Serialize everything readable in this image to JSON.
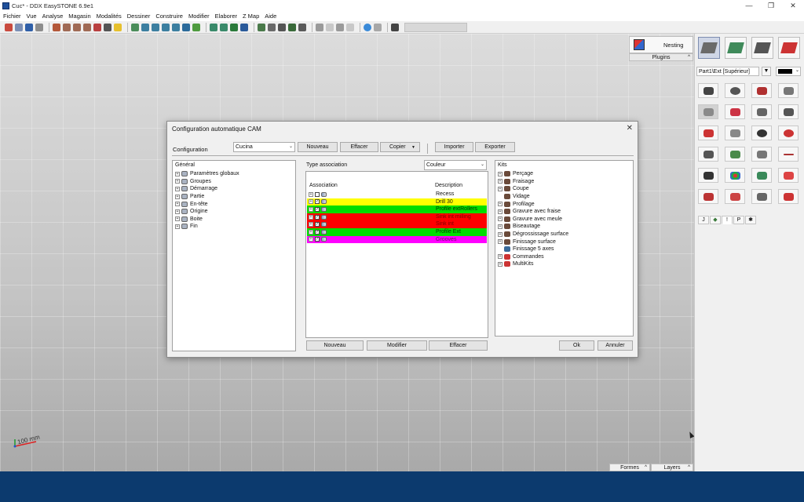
{
  "window": {
    "title": "Cuc* - DDX EasySTONE 6.9e1",
    "controls": [
      "—",
      "❐",
      "✕"
    ]
  },
  "menu": [
    "Fichier",
    "Vue",
    "Analyse",
    "Magasin",
    "Modalités",
    "Dessiner",
    "Construire",
    "Modifier",
    "Elaborer",
    "Z Map",
    "Aide"
  ],
  "viewport": {
    "scale_label": "100 mm"
  },
  "right_panel": {
    "nesting_label": "Nesting",
    "plugins_label": "Plugins",
    "part_view": "Part1\\Ext [Supérieur]",
    "current_color": "#000000"
  },
  "bottom_tabs": {
    "formes": "Formes",
    "layers": "Layers"
  },
  "dialog": {
    "title": "Configuration automatique CAM",
    "close": "✕",
    "config_label": "Configuration",
    "config_value": "Cucina",
    "top_buttons": {
      "new": "Nouveau",
      "delete": "Effacer",
      "copy": "Copier",
      "import": "Importer",
      "export": "Exporter"
    },
    "general": {
      "title": "Général",
      "items": [
        "Paramètres globaux",
        "Groupes",
        "Démarrage",
        "Partie",
        "En-tête",
        "Origine",
        "Boite",
        "Fin"
      ]
    },
    "association": {
      "type_label": "Type association",
      "type_value": "Couleur",
      "col_association": "Association",
      "col_description": "Description",
      "rows": [
        {
          "description": "Recess",
          "color": "#ffffff",
          "checked": false
        },
        {
          "description": "Drill 30",
          "color": "#ffff00",
          "checked": true
        },
        {
          "description": "Profile extRollers",
          "color": "#00dd00",
          "checked": true
        },
        {
          "description": "Sink int milling",
          "color": "#ff0000",
          "checked": true
        },
        {
          "description": "Sink int",
          "color": "#ff0000",
          "checked": true
        },
        {
          "description": "Profile Ext",
          "color": "#00dd00",
          "checked": true
        },
        {
          "description": "Grooves",
          "color": "#ff00ff",
          "checked": true
        }
      ],
      "buttons": {
        "new": "Nouveau",
        "modify": "Modifier",
        "delete": "Effacer"
      }
    },
    "kits": {
      "title": "Kits",
      "items": [
        "Perçage",
        "Fraisage",
        "Coupe",
        "Vidage",
        "Profilage",
        "Gravure avec fraise",
        "Gravure avec meule",
        "Biseautage",
        "Dégrossissage surface",
        "Finissage surface",
        "Finissage 5 axes",
        "Commandes",
        "MultiKits"
      ]
    },
    "ok": "Ok",
    "cancel": "Annuler"
  }
}
